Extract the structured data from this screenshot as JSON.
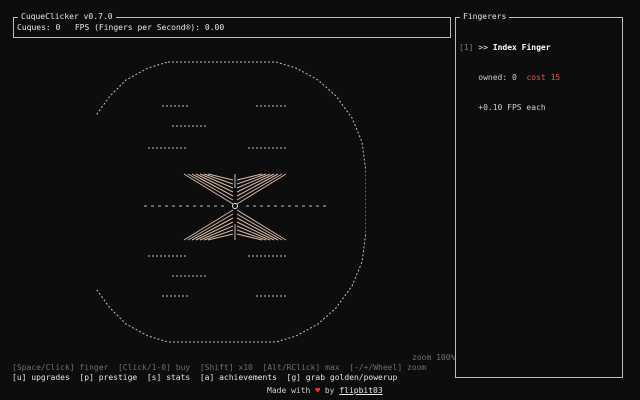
{
  "header": {
    "title": "CuqueClicker v0.7.0",
    "cuques_label": "Cuques:",
    "cuques_value": "0",
    "fps_label": "FPS (Fingers per Second®):",
    "fps_value": "0.00"
  },
  "fingerers": {
    "title": "Fingerers",
    "items": [
      {
        "hotkey": "[1]",
        "pointer": ">>",
        "name": "Index Finger",
        "owned_label": "owned:",
        "owned_value": "0",
        "cost_label": "cost",
        "cost_value": "15",
        "rate_text": "+0.10 FPS each"
      }
    ]
  },
  "zoom_text": "zoom 100%",
  "help": {
    "line1": "[Space/Click] finger  [Click/1-0] buy  [Shift] x10  [Alt/RClick] max  [-/+/Wheel] zoom",
    "line2": "[u] upgrades  [p] prestige  [s] stats  [a] achievements  [g] grab golden/powerup"
  },
  "credit": {
    "made_with": "Made with",
    "by": "by",
    "author": "flipbit03"
  },
  "colors": {
    "background": "#0d0d0d",
    "cost": "#e0584e",
    "heart": "#e03a3a",
    "art_ascii": "#d9b9a8",
    "art_center": "#bdbdbd"
  },
  "icons": [
    "heart-icon"
  ]
}
